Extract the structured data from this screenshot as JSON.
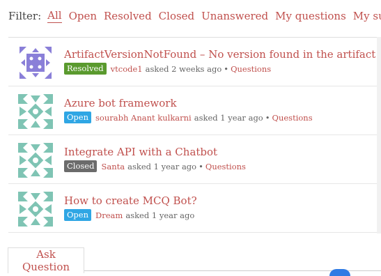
{
  "filter": {
    "label": "Filter:",
    "options": [
      "All",
      "Open",
      "Resolved",
      "Closed",
      "Unanswered",
      "My questions",
      "My subscribes"
    ],
    "active": "All"
  },
  "questions": [
    {
      "title": "ArtifactVersionNotFound – No version found in the artifact repository",
      "status": "Resolved",
      "status_color": "#5a9a2e",
      "user": "vtcode1",
      "asked": "asked 2 weeks ago",
      "sep": "•",
      "tag": "Questions",
      "avatar": "purple-dice-avatar"
    },
    {
      "title": "Azure bot framework",
      "status": "Open",
      "status_color": "#2fa6e4",
      "user": "sourabh Anant kulkarni",
      "asked": "asked 1 year ago",
      "sep": "•",
      "tag": "Questions",
      "avatar": "teal-pattern-avatar"
    },
    {
      "title": "Integrate API with a Chatbot",
      "status": "Closed",
      "status_color": "#6b6b6b",
      "user": "Santa",
      "asked": "asked 1 year ago",
      "sep": "•",
      "tag": "Questions",
      "avatar": "teal-pattern-avatar"
    },
    {
      "title": "How to create MCQ Bot?",
      "status": "Open",
      "status_color": "#2fa6e4",
      "user": "Dream",
      "asked": "asked 1 year ago",
      "sep": "",
      "tag": "",
      "avatar": "teal-pattern-avatar"
    }
  ],
  "ask_button": "Ask Question",
  "colors": {
    "link": "#c0504d",
    "avatar_teal": "#7fc4b4",
    "avatar_purple": "#8a7fd8"
  }
}
